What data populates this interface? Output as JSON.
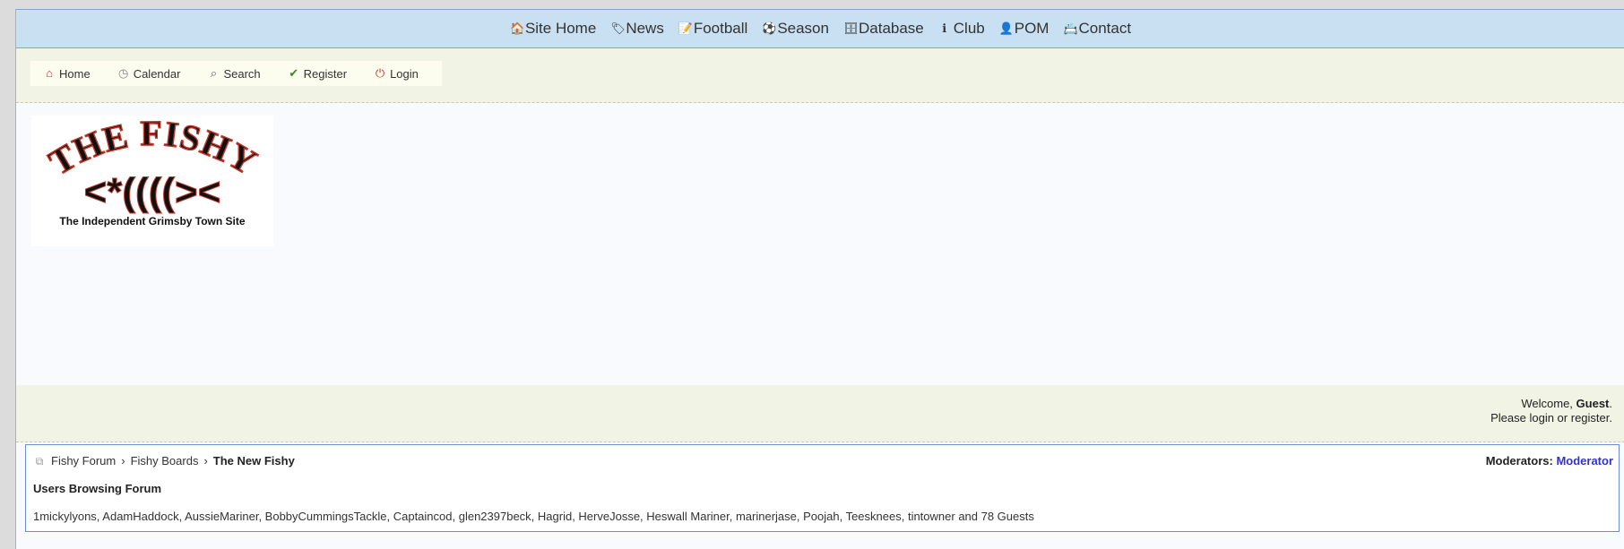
{
  "top_nav": [
    {
      "label": "Site Home",
      "icon": "home-icon"
    },
    {
      "label": "News",
      "icon": "tag-icon"
    },
    {
      "label": "Football",
      "icon": "pencil-icon"
    },
    {
      "label": "Season",
      "icon": "football-icon"
    },
    {
      "label": "Database",
      "icon": "database-icon"
    },
    {
      "label": "Club",
      "icon": "info-icon"
    },
    {
      "label": "POM",
      "icon": "user-icon"
    },
    {
      "label": "Contact",
      "icon": "contact-icon"
    }
  ],
  "sub_nav": [
    {
      "label": "Home",
      "icon": "home-icon"
    },
    {
      "label": "Calendar",
      "icon": "clock-icon"
    },
    {
      "label": "Search",
      "icon": "search-icon"
    },
    {
      "label": "Register",
      "icon": "check-icon"
    },
    {
      "label": "Login",
      "icon": "power-icon"
    }
  ],
  "logo": {
    "title": "THE FISHY",
    "fish": "<*((((>< ",
    "tagline": "The Independent Grimsby Town Site"
  },
  "welcome": {
    "prefix": "Welcome, ",
    "user": "Guest",
    "suffix": ".",
    "line2_prefix": "Please ",
    "login": "login",
    "or": " or ",
    "register": "register",
    "end": "."
  },
  "breadcrumb": {
    "items": [
      "Fishy Forum",
      "Fishy Boards"
    ],
    "separator": "›",
    "current": "The New Fishy"
  },
  "moderators": {
    "label": "Moderators: ",
    "name": "Moderator"
  },
  "users_browsing": {
    "title": "Users Browsing Forum",
    "list": "1mickylyons, AdamHaddock, AussieMariner, BobbyCummingsTackle, Captaincod, glen2397beck, Hagrid, HerveJosse, Heswall Mariner, marinerjase, Poojah, Teesknees, tintowner and 78 Guests"
  },
  "colors": {
    "top_nav_bg": "#c9dff2",
    "bar_bg": "#f1f3e4",
    "moderator_link": "#3333cc",
    "box_border": "#6b8fd6"
  }
}
